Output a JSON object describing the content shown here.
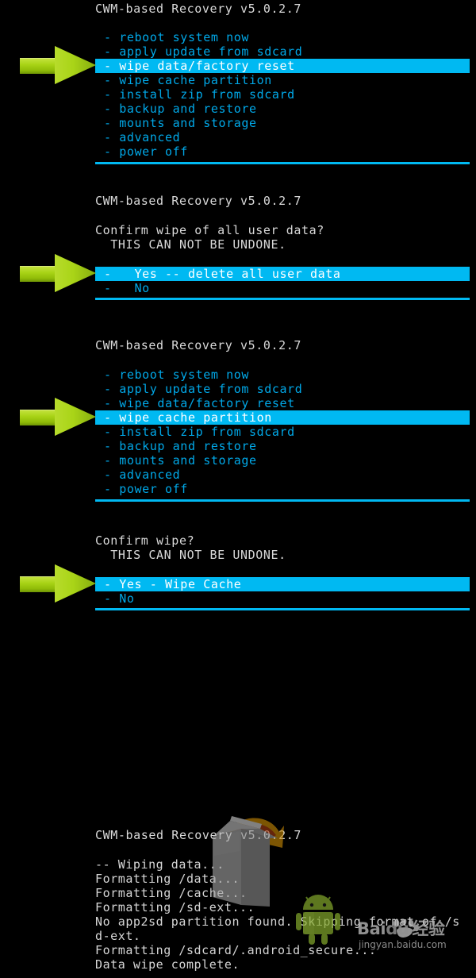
{
  "app": {
    "title": "CWM-based Recovery v5.0.2.7",
    "colors": {
      "background": "#000000",
      "menu_text": "#00a8e8",
      "selection_bar": "#00b9f2",
      "selection_text": "#ffffff",
      "header_text": "#d8d8d8",
      "rule": "#00b9f2",
      "arrow": "#a9d417"
    }
  },
  "panels": [
    {
      "name": "main-menu-wipe-data",
      "title": "CWM-based Recovery v5.0.2.7",
      "items": [
        "- reboot system now",
        "- apply update from sdcard",
        "- wipe data/factory reset",
        "- wipe cache partition",
        "- install zip from sdcard",
        "- backup and restore",
        "- mounts and storage",
        "- advanced",
        "- power off"
      ],
      "selected_index": 2,
      "selected_label": "- wipe data/factory reset"
    },
    {
      "name": "confirm-wipe-data",
      "title": "CWM-based Recovery v5.0.2.7",
      "prompt": "Confirm wipe of all user data?",
      "warning": "  THIS CAN NOT BE UNDONE.",
      "items": [
        "-   Yes -- delete all user data",
        "-   No"
      ],
      "selected_index": 0,
      "selected_label": "-   Yes -- delete all user data"
    },
    {
      "name": "main-menu-wipe-cache",
      "title": "CWM-based Recovery v5.0.2.7",
      "items": [
        "- reboot system now",
        "- apply update from sdcard",
        "- wipe data/factory reset",
        "- wipe cache partition",
        "- install zip from sdcard",
        "- backup and restore",
        "- mounts and storage",
        "- advanced",
        "- power off"
      ],
      "selected_index": 3,
      "selected_label": "- wipe cache partition"
    },
    {
      "name": "confirm-wipe-cache",
      "prompt": "Confirm wipe?",
      "warning": "  THIS CAN NOT BE UNDONE.",
      "items": [
        "- Yes - Wipe Cache",
        "- No"
      ],
      "selected_index": 0,
      "selected_label": "- Yes - Wipe Cache"
    }
  ],
  "log_panel": {
    "name": "wipe-progress-log",
    "title": "CWM-based Recovery v5.0.2.7",
    "lines": [
      "-- Wiping data...",
      "Formatting /data...",
      "Formatting /cache...",
      "Formatting /sd-ext...",
      "No app2sd partition found. Skipping format of /s",
      "d-ext.",
      "Formatting /sdcard/.android_secure...",
      "Data wipe complete."
    ]
  },
  "watermark": {
    "brand": "Bai  du 经验",
    "brand_latin": "Bai",
    "brand_du": "du",
    "brand_cn": "经验",
    "url": "jingyan.baidu.com"
  }
}
